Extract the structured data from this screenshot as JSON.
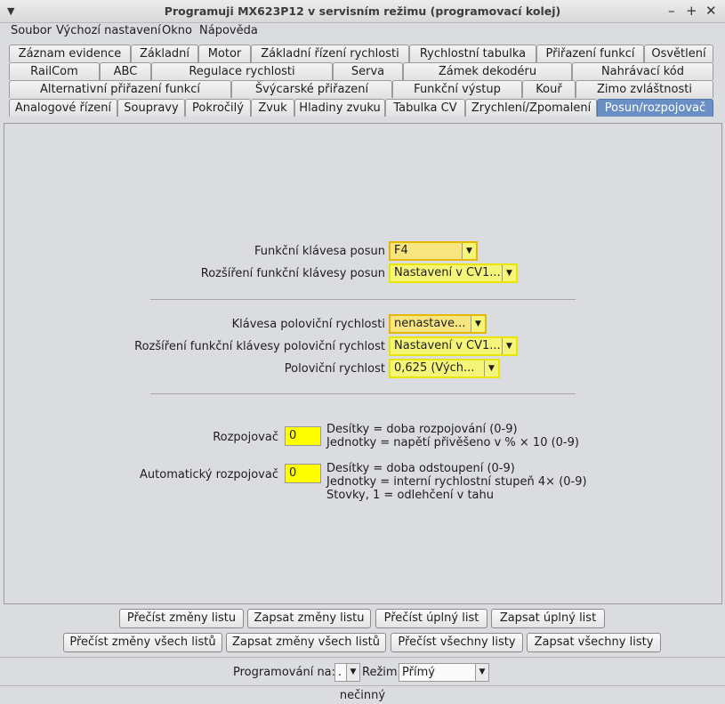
{
  "window": {
    "title": "Programuji MX623P12 v servisním režimu (programovací kolej)",
    "menu_icon": "chevron-down-icon",
    "minimize": "–",
    "maximize": "+",
    "close": "✕"
  },
  "menu": [
    "Soubor",
    "Výchozí nastavení",
    "Okno",
    "Nápověda"
  ],
  "tabs": {
    "row1": [
      "Záznam evidence",
      "Základní",
      "Motor",
      "Základní řízení rychlosti",
      "Rychlostní tabulka",
      "Přiřazení funkcí",
      "Osvětlení"
    ],
    "row2": [
      "RailCom",
      "ABC",
      "Regulace rychlosti",
      "Serva",
      "Zámek dekodéru",
      "Nahrávací kód"
    ],
    "row3": [
      "Alternativní přiřazení funkcí",
      "Švýcarské přiřazení",
      "Funkční výstup",
      "Kouř",
      "Zimo zvláštnosti"
    ],
    "row4": [
      "Analogové řízení",
      "Soupravy",
      "Pokročilý",
      "Zvuk",
      "Hladiny zvuku",
      "Tabulka CV",
      "Zrychlení/Zpomalení",
      "Posun/rozpojovač"
    ],
    "active": "Posun/rozpojovač"
  },
  "form": {
    "shunting_key_label": "Funkční klávesa posun",
    "shunting_key_value": "F4",
    "shunting_ext_label": "Rozšíření funkční klávesy posun",
    "shunting_ext_value": "Nastavení v CV1...",
    "half_speed_key_label": "Klávesa poloviční rychlosti",
    "half_speed_key_value": "nenastave...",
    "half_speed_ext_label": "Rozšíření funkční klávesy poloviční rychlost",
    "half_speed_ext_value": "Nastavení v CV1...",
    "half_speed_label": "Poloviční rychlost",
    "half_speed_value": "0,625 (Vých...",
    "uncoupler_label": "Rozpojovač",
    "uncoupler_value": "0",
    "uncoupler_help_1": "Desítky = doba rozpojování (0-9)",
    "uncoupler_help_2": "Jednotky = napětí přivěšeno v % × 10 (0-9)",
    "auto_uncoupler_label": "Automatický rozpojovač",
    "auto_uncoupler_value": "0",
    "auto_help_1": "Desítky = doba odstoupení (0-9)",
    "auto_help_2": "Jednotky = interní rychlostní stupeň 4× (0-9)",
    "auto_help_3": "Stovky, 1 = odlehčení v tahu"
  },
  "buttons": {
    "read_changes_sheet": "Přečíst změny listu",
    "write_changes_sheet": "Zapsat změny listu",
    "read_full_sheet": "Přečíst úplný list",
    "write_full_sheet": "Zapsat úplný list",
    "read_changes_all": "Přečíst změny všech listů",
    "write_changes_all": "Zapsat změny všech listů",
    "read_all": "Přečíst všechny listy",
    "write_all": "Zapsat všechny listy"
  },
  "footer": {
    "programming_on_label": "Programování na:",
    "programming_on_value": ".",
    "mode_label": "Režim:",
    "mode_value": "Přímý",
    "status": "nečinný"
  },
  "colors": {
    "active_tab": "#6a8fc4",
    "field_yellow": "#ffff00",
    "combo_border": "#e6e600",
    "combo_border_focus": "#e6b800"
  }
}
